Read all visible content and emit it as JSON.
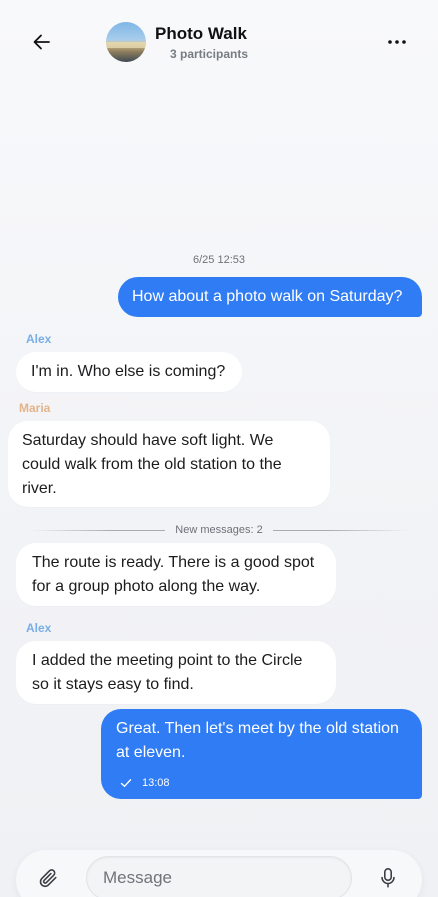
{
  "header": {
    "title": "Photo Walk",
    "participants": "3 participants",
    "back_icon": "arrow-left-icon",
    "more_icon": "more-horizontal-icon"
  },
  "chat": {
    "timestamp": "6/25 12:53",
    "messages": [
      {
        "direction": "out",
        "text": "How about a photo walk on Saturday?"
      },
      {
        "direction": "in",
        "sender": "Alex",
        "text": "I'm in. Who else is coming?"
      },
      {
        "direction": "in",
        "sender": "Maria",
        "text": "Saturday should have soft light. We could walk from the old station to the river."
      },
      {
        "direction": "in",
        "text": "The route is ready. There is a good spot for a group photo along the way."
      },
      {
        "direction": "in",
        "sender": "Alex",
        "text": "I added the meeting point to the Circle so it stays easy to find."
      },
      {
        "direction": "out",
        "text": "Great. Then let's meet by the old station at eleven.",
        "time": "13:08",
        "status_icon": "check-icon"
      }
    ],
    "new_messages_label": "New messages: 2"
  },
  "composer": {
    "placeholder": "Message",
    "value": "",
    "attach_icon": "paperclip-icon",
    "mic_icon": "microphone-icon"
  },
  "colors": {
    "outgoing_bubble": "#2f7cf4",
    "incoming_bubble": "#ffffff",
    "sender_alex": "#78aee6",
    "sender_maria": "#e3b48a",
    "background": "#f4f5f7"
  }
}
